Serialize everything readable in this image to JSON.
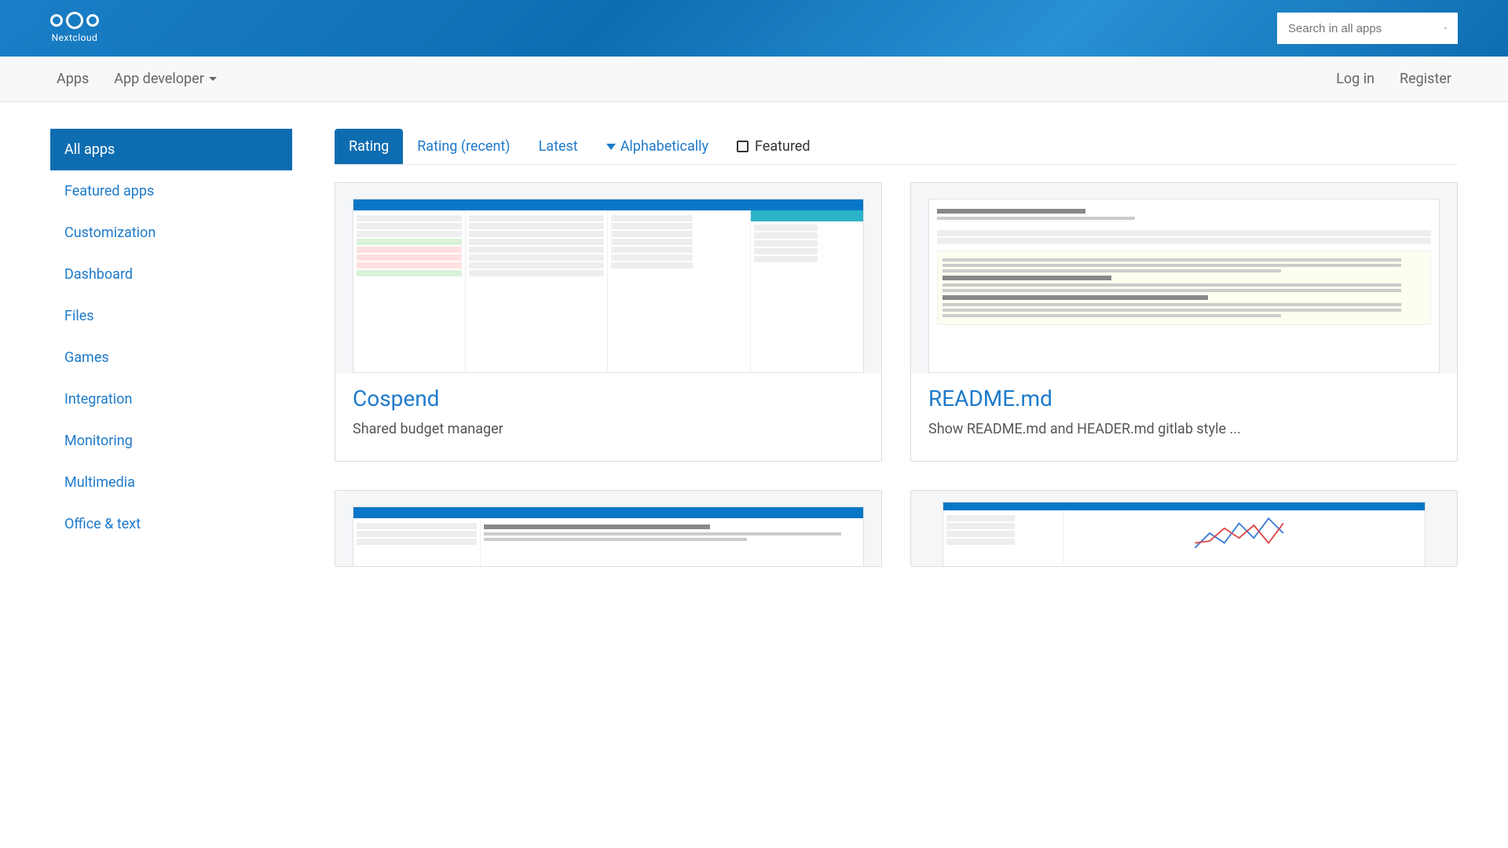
{
  "header": {
    "logo_text": "Nextcloud",
    "search_placeholder": "Search in all apps"
  },
  "nav": {
    "apps": "Apps",
    "app_developer": "App developer",
    "login": "Log in",
    "register": "Register"
  },
  "sidebar": {
    "items": [
      "All apps",
      "Featured apps",
      "Customization",
      "Dashboard",
      "Files",
      "Games",
      "Integration",
      "Monitoring",
      "Multimedia",
      "Office & text"
    ]
  },
  "tabs": {
    "rating": "Rating",
    "rating_recent": "Rating (recent)",
    "latest": "Latest",
    "alphabetically": "Alphabetically",
    "featured": "Featured"
  },
  "apps": [
    {
      "title": "Cospend",
      "desc": "Shared budget manager"
    },
    {
      "title": "README.md",
      "desc": "Show README.md and HEADER.md gitlab style ..."
    }
  ]
}
